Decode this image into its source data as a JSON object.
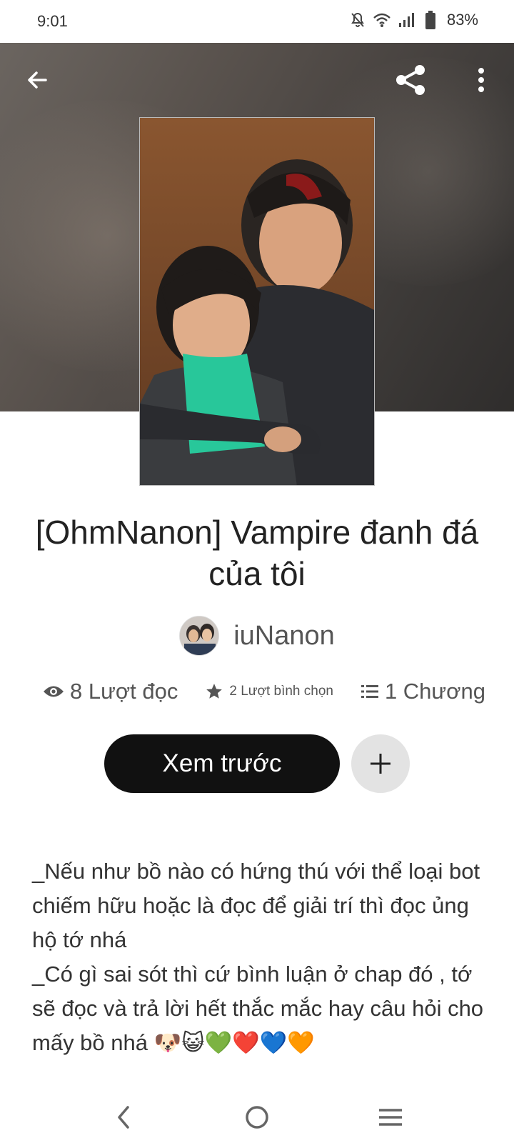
{
  "status": {
    "time": "9:01",
    "battery": "83%",
    "icons": [
      "mute-bell-icon",
      "wifi-icon",
      "signal-icon",
      "battery-icon"
    ]
  },
  "toolbar": {
    "icons": [
      "back-arrow-icon",
      "share-icon",
      "more-vert-icon"
    ]
  },
  "story": {
    "title": "[OhmNanon] Vampire đanh đá của tôi",
    "author": "iuNanon",
    "stats": {
      "reads": "8 Lượt đọc",
      "votes": "2 Lượt bình chọn",
      "chapters": "1 Chương"
    },
    "preview_label": "Xem trước",
    "description": "_Nếu như bồ nào có hứng thú với thể loại bot chiếm hữu hoặc là đọc để giải trí thì đọc ủng hộ tớ nhá\n_Có gì sai sót thì cứ bình luận ở chap đó , tớ sẽ đọc và trả lời hết thắc mắc hay câu hỏi cho mấy bồ nhá 🐶😺💚❤️💙🧡"
  },
  "navbar": {
    "icons": [
      "nav-back-icon",
      "nav-home-icon",
      "nav-recents-icon"
    ]
  },
  "colors": {
    "primary_button": "#111111",
    "add_button": "#e3e3e3",
    "text": "#222222"
  }
}
